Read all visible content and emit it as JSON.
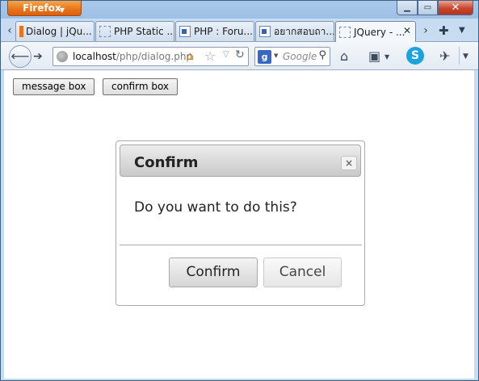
{
  "browser": {
    "menu_label": "Firefox",
    "window_controls": {
      "minimize": "▁",
      "maximize": "▭",
      "close": "✕"
    }
  },
  "tabs": [
    {
      "label": "Dialog | jQu...",
      "icon": "orange-favicon"
    },
    {
      "label": "PHP Static ...",
      "icon": "blank-page-icon"
    },
    {
      "label": "PHP : Foru...",
      "icon": "page-favicon"
    },
    {
      "label": "อยากสอบถา...",
      "icon": "page-favicon"
    },
    {
      "label": "JQuery - ...",
      "icon": "blank-page-icon",
      "active": true
    }
  ],
  "navbar": {
    "url_host": "localhost",
    "url_path": "/php/dialog.php",
    "search_placeholder": "Google",
    "search_engine_letter": "g"
  },
  "page": {
    "buttons": {
      "message_box": "message box",
      "confirm_box": "confirm box"
    }
  },
  "dialog": {
    "title": "Confirm",
    "close_glyph": "×",
    "message": "Do you want to do this?",
    "confirm_label": "Confirm",
    "cancel_label": "Cancel"
  }
}
